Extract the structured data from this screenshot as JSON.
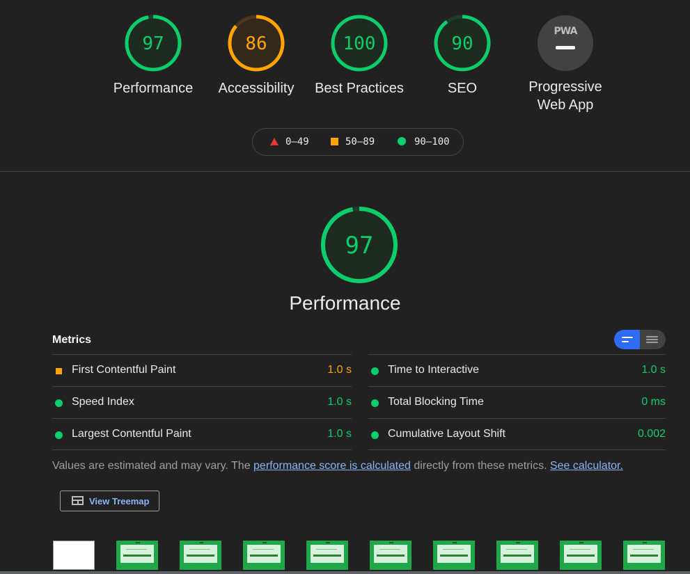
{
  "summary_gauges": [
    {
      "label": "Performance",
      "score": "97",
      "status": "pass"
    },
    {
      "label": "Accessibility",
      "score": "86",
      "status": "average"
    },
    {
      "label": "Best Practices",
      "score": "100",
      "status": "pass"
    },
    {
      "label": "SEO",
      "score": "90",
      "status": "pass"
    }
  ],
  "pwa": {
    "badge": "PWA",
    "label_line1": "Progressive",
    "label_line2": "Web App"
  },
  "legend": {
    "fail": "0–49",
    "average": "50–89",
    "pass": "90–100"
  },
  "performance": {
    "score": "97",
    "title": "Performance"
  },
  "metrics": {
    "header": "Metrics",
    "left": [
      {
        "title": "First Contentful Paint",
        "value": "1.0 s",
        "status": "average"
      },
      {
        "title": "Speed Index",
        "value": "1.0 s",
        "status": "pass"
      },
      {
        "title": "Largest Contentful Paint",
        "value": "1.0 s",
        "status": "pass"
      }
    ],
    "right": [
      {
        "title": "Time to Interactive",
        "value": "1.0 s",
        "status": "pass"
      },
      {
        "title": "Total Blocking Time",
        "value": "0 ms",
        "status": "pass"
      },
      {
        "title": "Cumulative Layout Shift",
        "value": "0.002",
        "status": "pass"
      }
    ]
  },
  "disclaimer": {
    "text1": "Values are estimated and may vary. The ",
    "link1": "performance score is calculated",
    "text2": " directly from these metrics. ",
    "link2": "See calculator."
  },
  "treemap": {
    "label": "View Treemap"
  },
  "colors": {
    "pass": "#0cce6b",
    "average": "#ffa400",
    "fail": "#e53935",
    "accent": "#2d6bf4"
  },
  "filmstrip": {
    "frames": [
      "blank",
      "page",
      "page",
      "page",
      "page",
      "page",
      "page",
      "page",
      "page",
      "page"
    ]
  }
}
